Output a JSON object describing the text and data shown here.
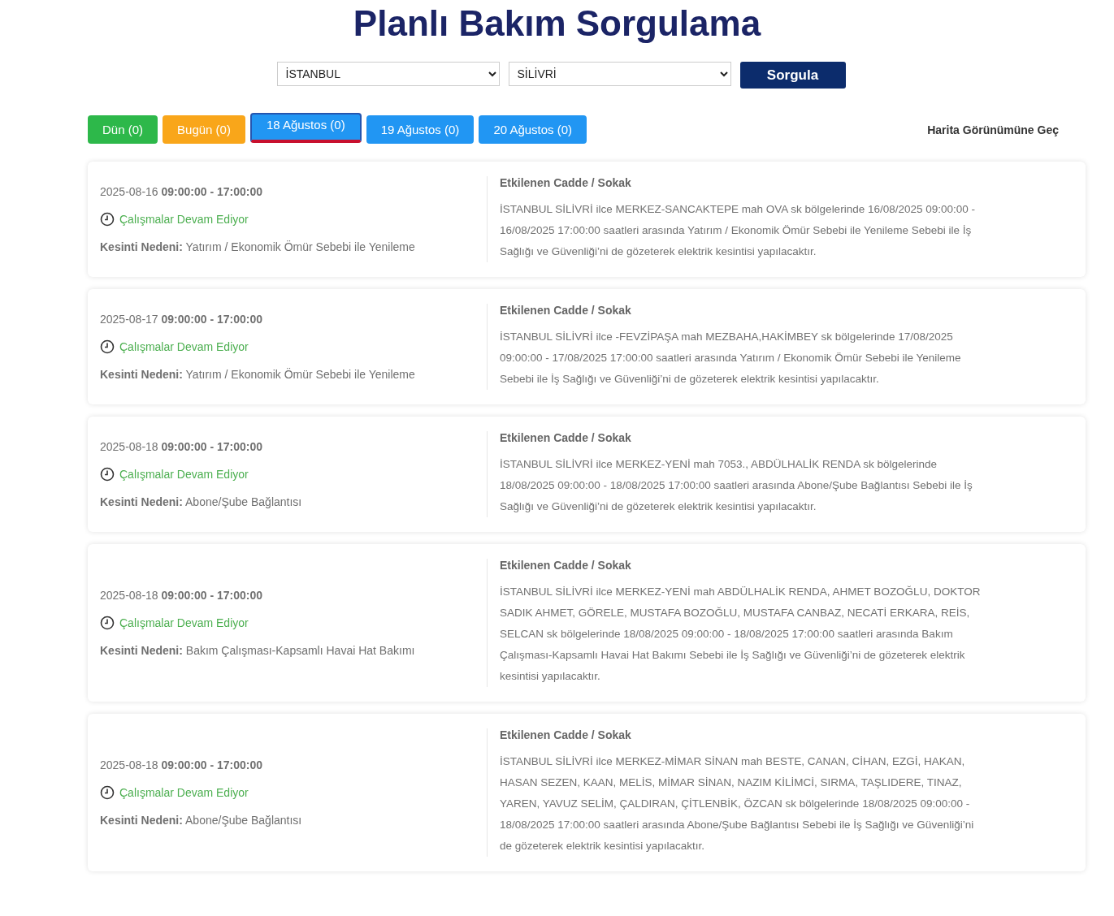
{
  "title": "Planlı Bakım Sorgulama",
  "query": {
    "province": "İSTANBUL",
    "district": "SİLİVRİ",
    "button": "Sorgula"
  },
  "tabs": [
    {
      "label": "Dün (0)",
      "color": "#2db84a",
      "selected": false
    },
    {
      "label": "Bugün (0)",
      "color": "#f9a61a",
      "selected": false
    },
    {
      "label": "18 Ağustos (0)",
      "color": "#2196f3",
      "selected": true
    },
    {
      "label": "19 Ağustos (0)",
      "color": "#2196f3",
      "selected": false
    },
    {
      "label": "20 Ağustos (0)",
      "color": "#2196f3",
      "selected": false
    }
  ],
  "map_link": "Harita Görünümüne Geç",
  "outages": [
    {
      "when": "2025-08-16 **09:00:00 - 17:00:00**",
      "status": "Çalışmalar Devam Ediyor",
      "reason": "**Kesinti Nedeni:** Yatırım / Ekonomik Ömür Sebebi ile Yenileme",
      "streets_heading": "Etkilenen Cadde / Sokak",
      "description": "İSTANBUL SİLİVRİ ilce MERKEZ-SANCAKTEPE mah OVA sk bölgelerinde 16/08/2025 09:00:00 - 16/08/2025 17:00:00 saatleri arasında Yatırım / Ekonomik Ömür Sebebi ile Yenileme Sebebi ile İş Sağlığı ve Güvenliği’ni de gözeterek elektrik kesintisi yapılacaktır."
    },
    {
      "when": "2025-08-17 **09:00:00 - 17:00:00**",
      "status": "Çalışmalar Devam Ediyor",
      "reason": "**Kesinti Nedeni:** Yatırım / Ekonomik Ömür Sebebi ile Yenileme",
      "streets_heading": "Etkilenen Cadde / Sokak",
      "description": "İSTANBUL SİLİVRİ ilce -FEVZİPAŞA mah MEZBAHA,HAKİMBEY sk bölgelerinde 17/08/2025 09:00:00 - 17/08/2025 17:00:00 saatleri arasında Yatırım / Ekonomik Ömür Sebebi ile Yenileme Sebebi ile İş Sağlığı ve Güvenliği’ni de gözeterek elektrik kesintisi yapılacaktır."
    },
    {
      "when": "2025-08-18 **09:00:00 - 17:00:00**",
      "status": "Çalışmalar Devam Ediyor",
      "reason": "**Kesinti Nedeni:** Abone/Şube Bağlantısı",
      "streets_heading": "Etkilenen Cadde / Sokak",
      "description": "İSTANBUL SİLİVRİ ilce MERKEZ-YENİ mah 7053., ABDÜLHALİK RENDA sk bölgelerinde 18/08/2025 09:00:00 - 18/08/2025 17:00:00 saatleri arasında Abone/Şube Bağlantısı Sebebi ile İş Sağlığı ve Güvenliği’ni de gözeterek elektrik kesintisi yapılacaktır."
    },
    {
      "when": "2025-08-18 **09:00:00 - 17:00:00**",
      "status": "Çalışmalar Devam Ediyor",
      "reason": "**Kesinti Nedeni:** Bakım Çalışması-Kapsamlı Havai Hat Bakımı",
      "streets_heading": "Etkilenen Cadde / Sokak",
      "description": "İSTANBUL SİLİVRİ ilce MERKEZ-YENİ mah ABDÜLHALİK RENDA, AHMET BOZOĞLU, DOKTOR SADIK AHMET, GÖRELE, MUSTAFA BOZOĞLU, MUSTAFA CANBAZ, NECATİ ERKARA, REİS, SELCAN sk bölgelerinde 18/08/2025 09:00:00 - 18/08/2025 17:00:00 saatleri arasında Bakım Çalışması-Kapsamlı Havai Hat Bakımı Sebebi ile İş Sağlığı ve Güvenliği’ni de gözeterek elektrik kesintisi yapılacaktır."
    },
    {
      "when": "2025-08-18 **09:00:00 - 17:00:00**",
      "status": "Çalışmalar Devam Ediyor",
      "reason": "**Kesinti Nedeni:** Abone/Şube Bağlantısı",
      "streets_heading": "Etkilenen Cadde / Sokak",
      "description": "İSTANBUL SİLİVRİ ilce MERKEZ-MİMAR SİNAN mah BESTE, CANAN, CİHAN, EZGİ, HAKAN, HASAN SEZEN, KAAN, MELİS, MİMAR SİNAN, NAZIM KİLİMCİ, SIRMA, TAŞLIDERE, TINAZ, YAREN, YAVUZ SELİM, ÇALDIRAN, ÇİTLENBİK, ÖZCAN sk bölgelerinde 18/08/2025 09:00:00 - 18/08/2025 17:00:00 saatleri arasında Abone/Şube Bağlantısı Sebebi ile İş Sağlığı ve Güvenliği’ni de gözeterek elektrik kesintisi yapılacaktır."
    }
  ]
}
